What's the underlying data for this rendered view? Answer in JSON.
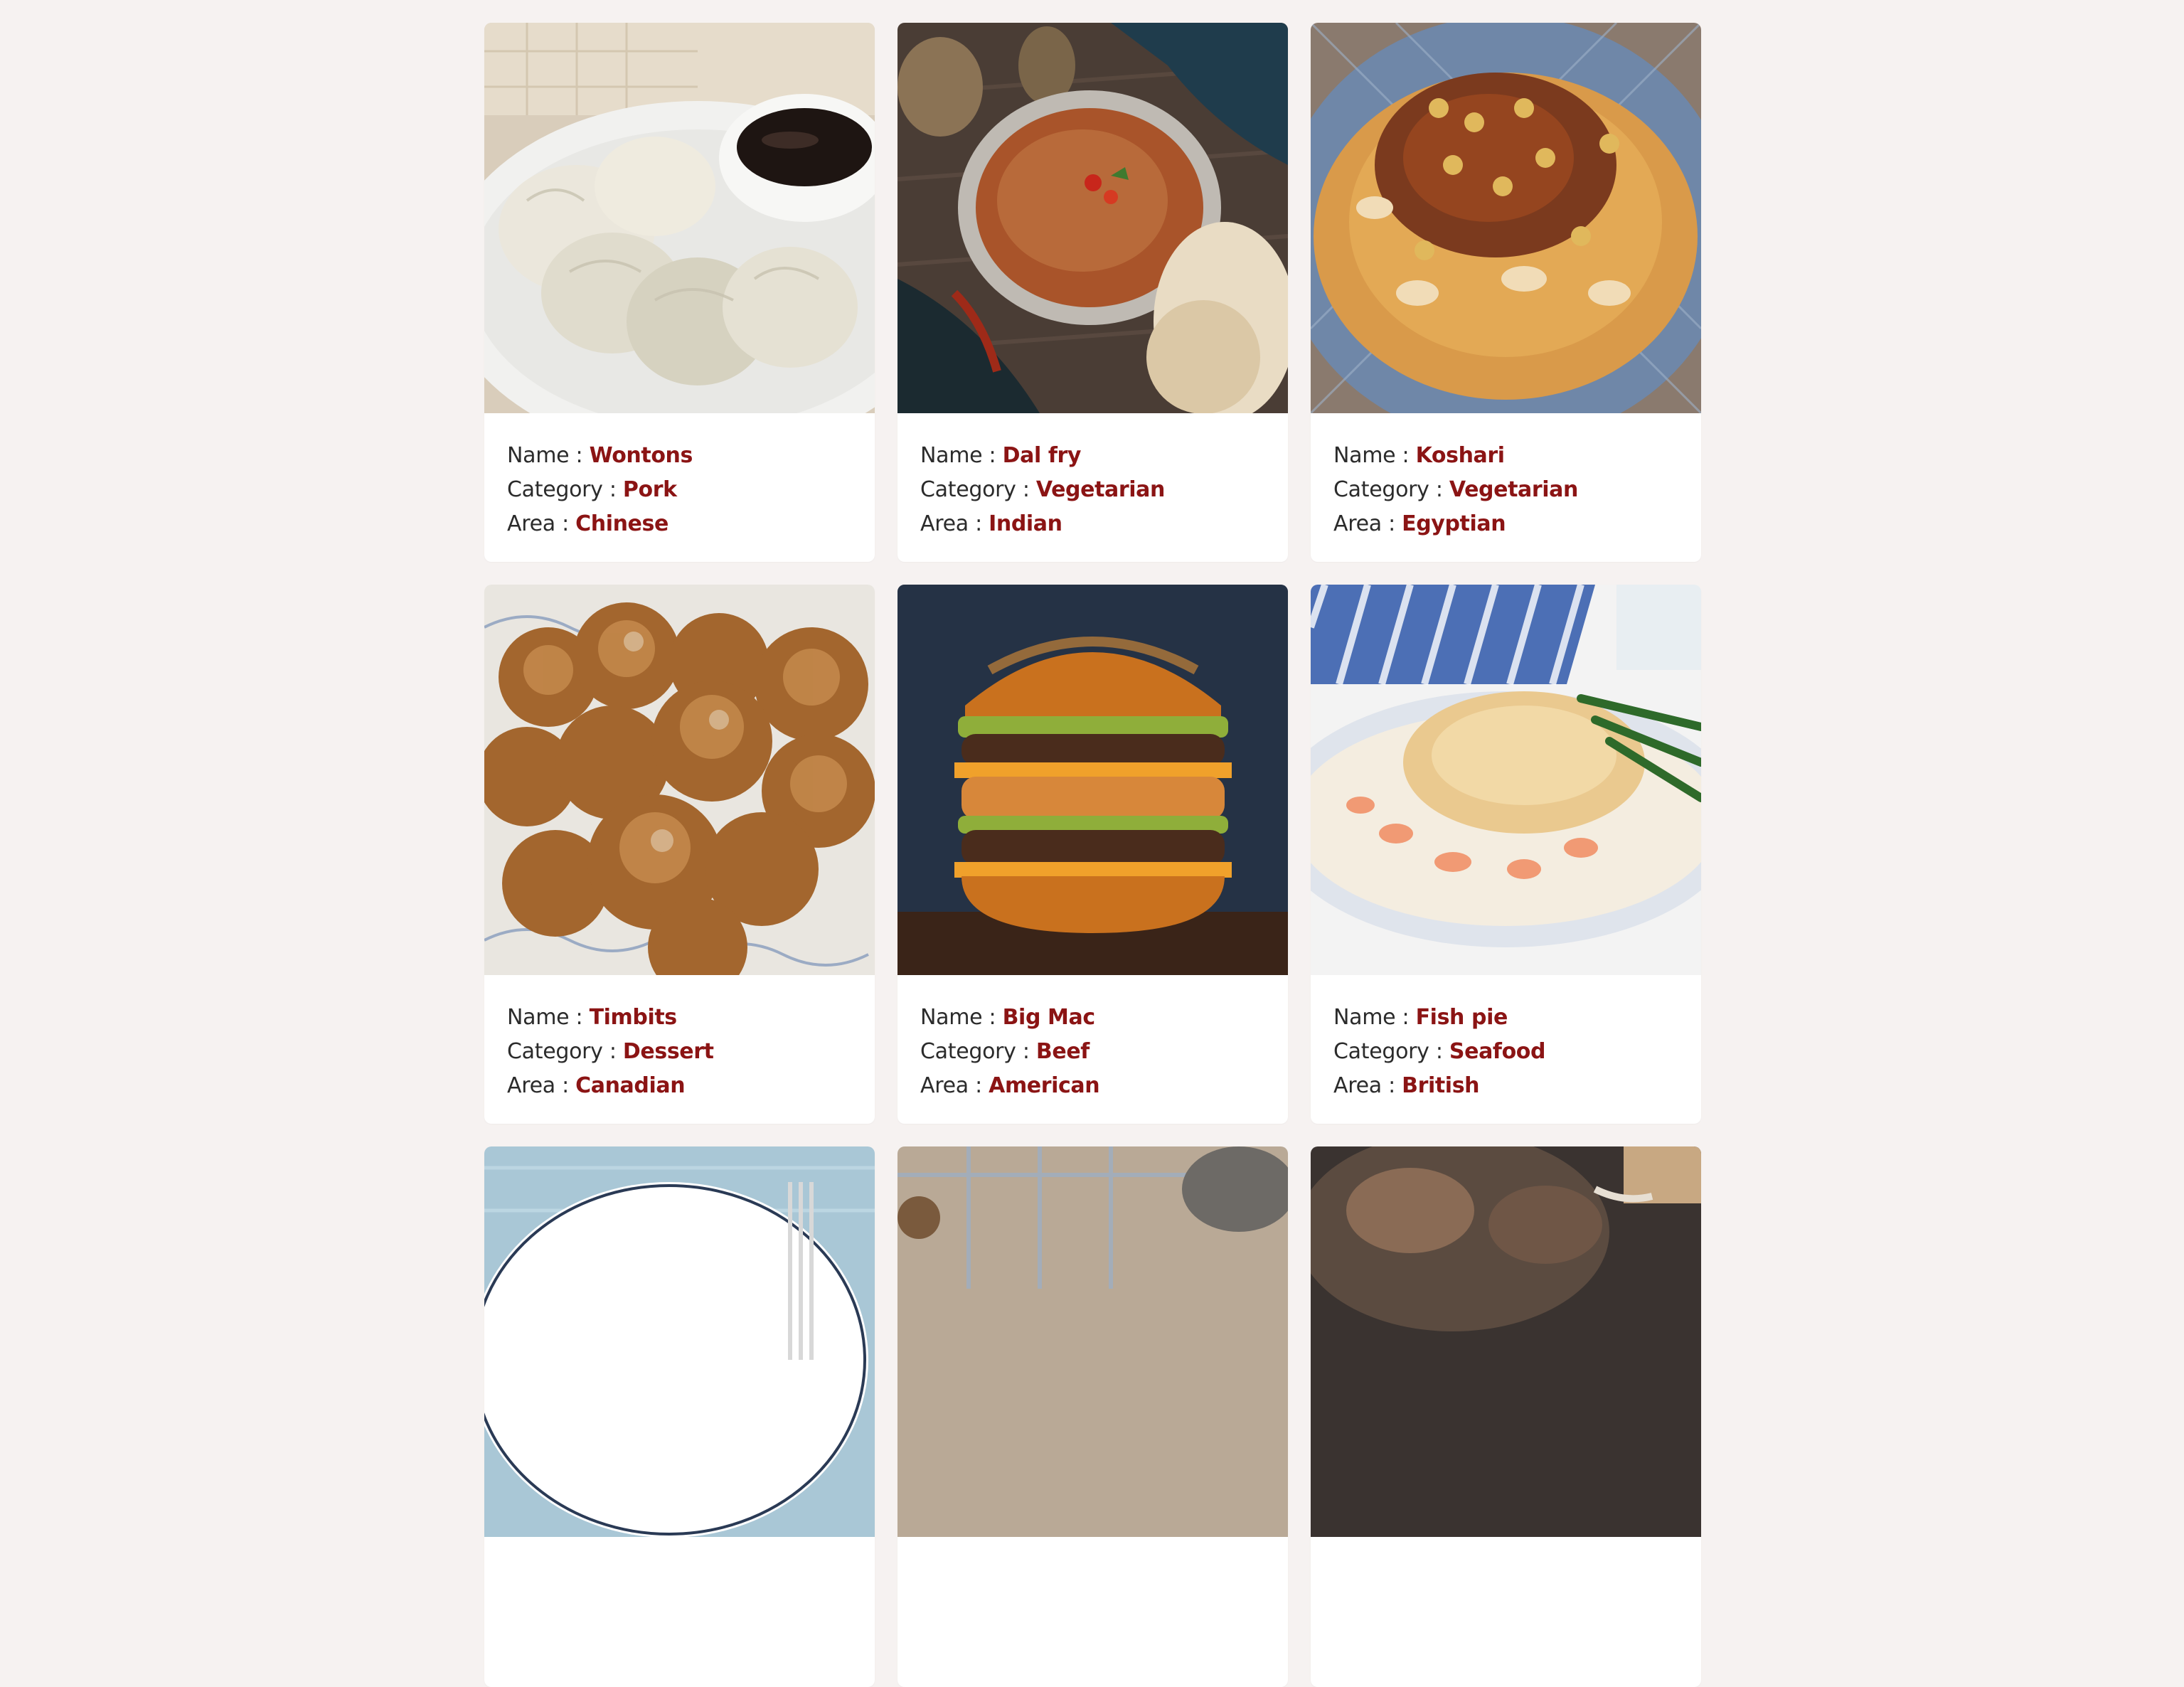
{
  "labels": {
    "name": "Name : ",
    "category": "Category : ",
    "area": "Area : "
  },
  "meals": [
    {
      "name": "Wontons",
      "category": "Pork",
      "area": "Chinese",
      "image_icon": "dumplings-photo"
    },
    {
      "name": "Dal fry",
      "category": "Vegetarian",
      "area": "Indian",
      "image_icon": "curry-bowl-photo"
    },
    {
      "name": "Koshari",
      "category": "Vegetarian",
      "area": "Egyptian",
      "image_icon": "rice-pasta-plate-photo"
    },
    {
      "name": "Timbits",
      "category": "Dessert",
      "area": "Canadian",
      "image_icon": "donut-holes-photo"
    },
    {
      "name": "Big Mac",
      "category": "Beef",
      "area": "American",
      "image_icon": "burger-photo"
    },
    {
      "name": "Fish pie",
      "category": "Seafood",
      "area": "British",
      "image_icon": "fish-pie-photo"
    },
    {
      "image_icon": "plate-fork-photo"
    },
    {
      "image_icon": "kitchen-table-photo"
    },
    {
      "image_icon": "roast-dish-photo"
    }
  ],
  "colors": {
    "background": "#f6f2f1",
    "card": "#ffffff",
    "accent": "#8b1414"
  }
}
